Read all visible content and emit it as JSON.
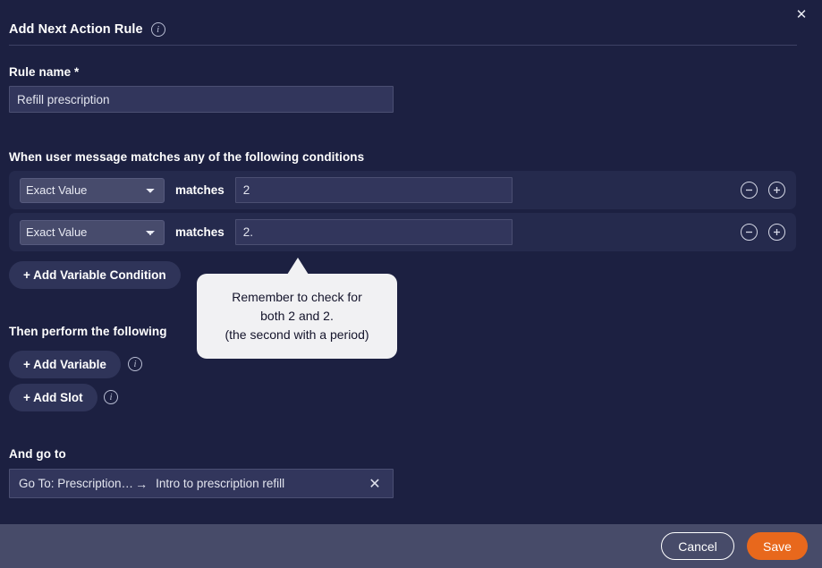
{
  "colors": {
    "background": "#1c2041",
    "row_background": "#252a4d",
    "input_background": "#32365c",
    "select_background": "#474b6c",
    "footer_background": "#474b69",
    "accent_save": "#e8681c",
    "callout_background": "#f1f1f3",
    "divider": "#3d4165"
  },
  "header": {
    "title": "Add Next Action Rule",
    "info_icon": "info-icon",
    "close_icon": "close-icon"
  },
  "rule_name": {
    "label": "Rule name *",
    "value": "Refill prescription",
    "placeholder": "Rule name"
  },
  "conditions": {
    "label": "When user message matches any of the following conditions",
    "matches_label": "matches",
    "operator_options": [
      "Exact Value"
    ],
    "remove_icon": "minus-circle-icon",
    "add_icon": "plus-circle-icon",
    "rows": [
      {
        "operator": "Exact Value",
        "value": "2",
        "placeholder": "Value"
      },
      {
        "operator": "Exact Value",
        "value": "2.",
        "placeholder": "Value"
      }
    ],
    "add_variable_condition_label": "+ Add Variable Condition"
  },
  "callout": {
    "lines": [
      "Remember to check for",
      "both 2 and 2.",
      "(the second with a period)"
    ]
  },
  "actions": {
    "label": "Then perform the following",
    "add_variable_label": "+ Add Variable",
    "add_slot_label": "+ Add Slot",
    "info_icon": "info-icon"
  },
  "goto": {
    "label": "And go to",
    "target": "Go To: Prescription…",
    "arrow": "→",
    "destination": "Intro to prescription refill",
    "remove_icon": "close-icon"
  },
  "footer": {
    "cancel_label": "Cancel",
    "save_label": "Save"
  }
}
